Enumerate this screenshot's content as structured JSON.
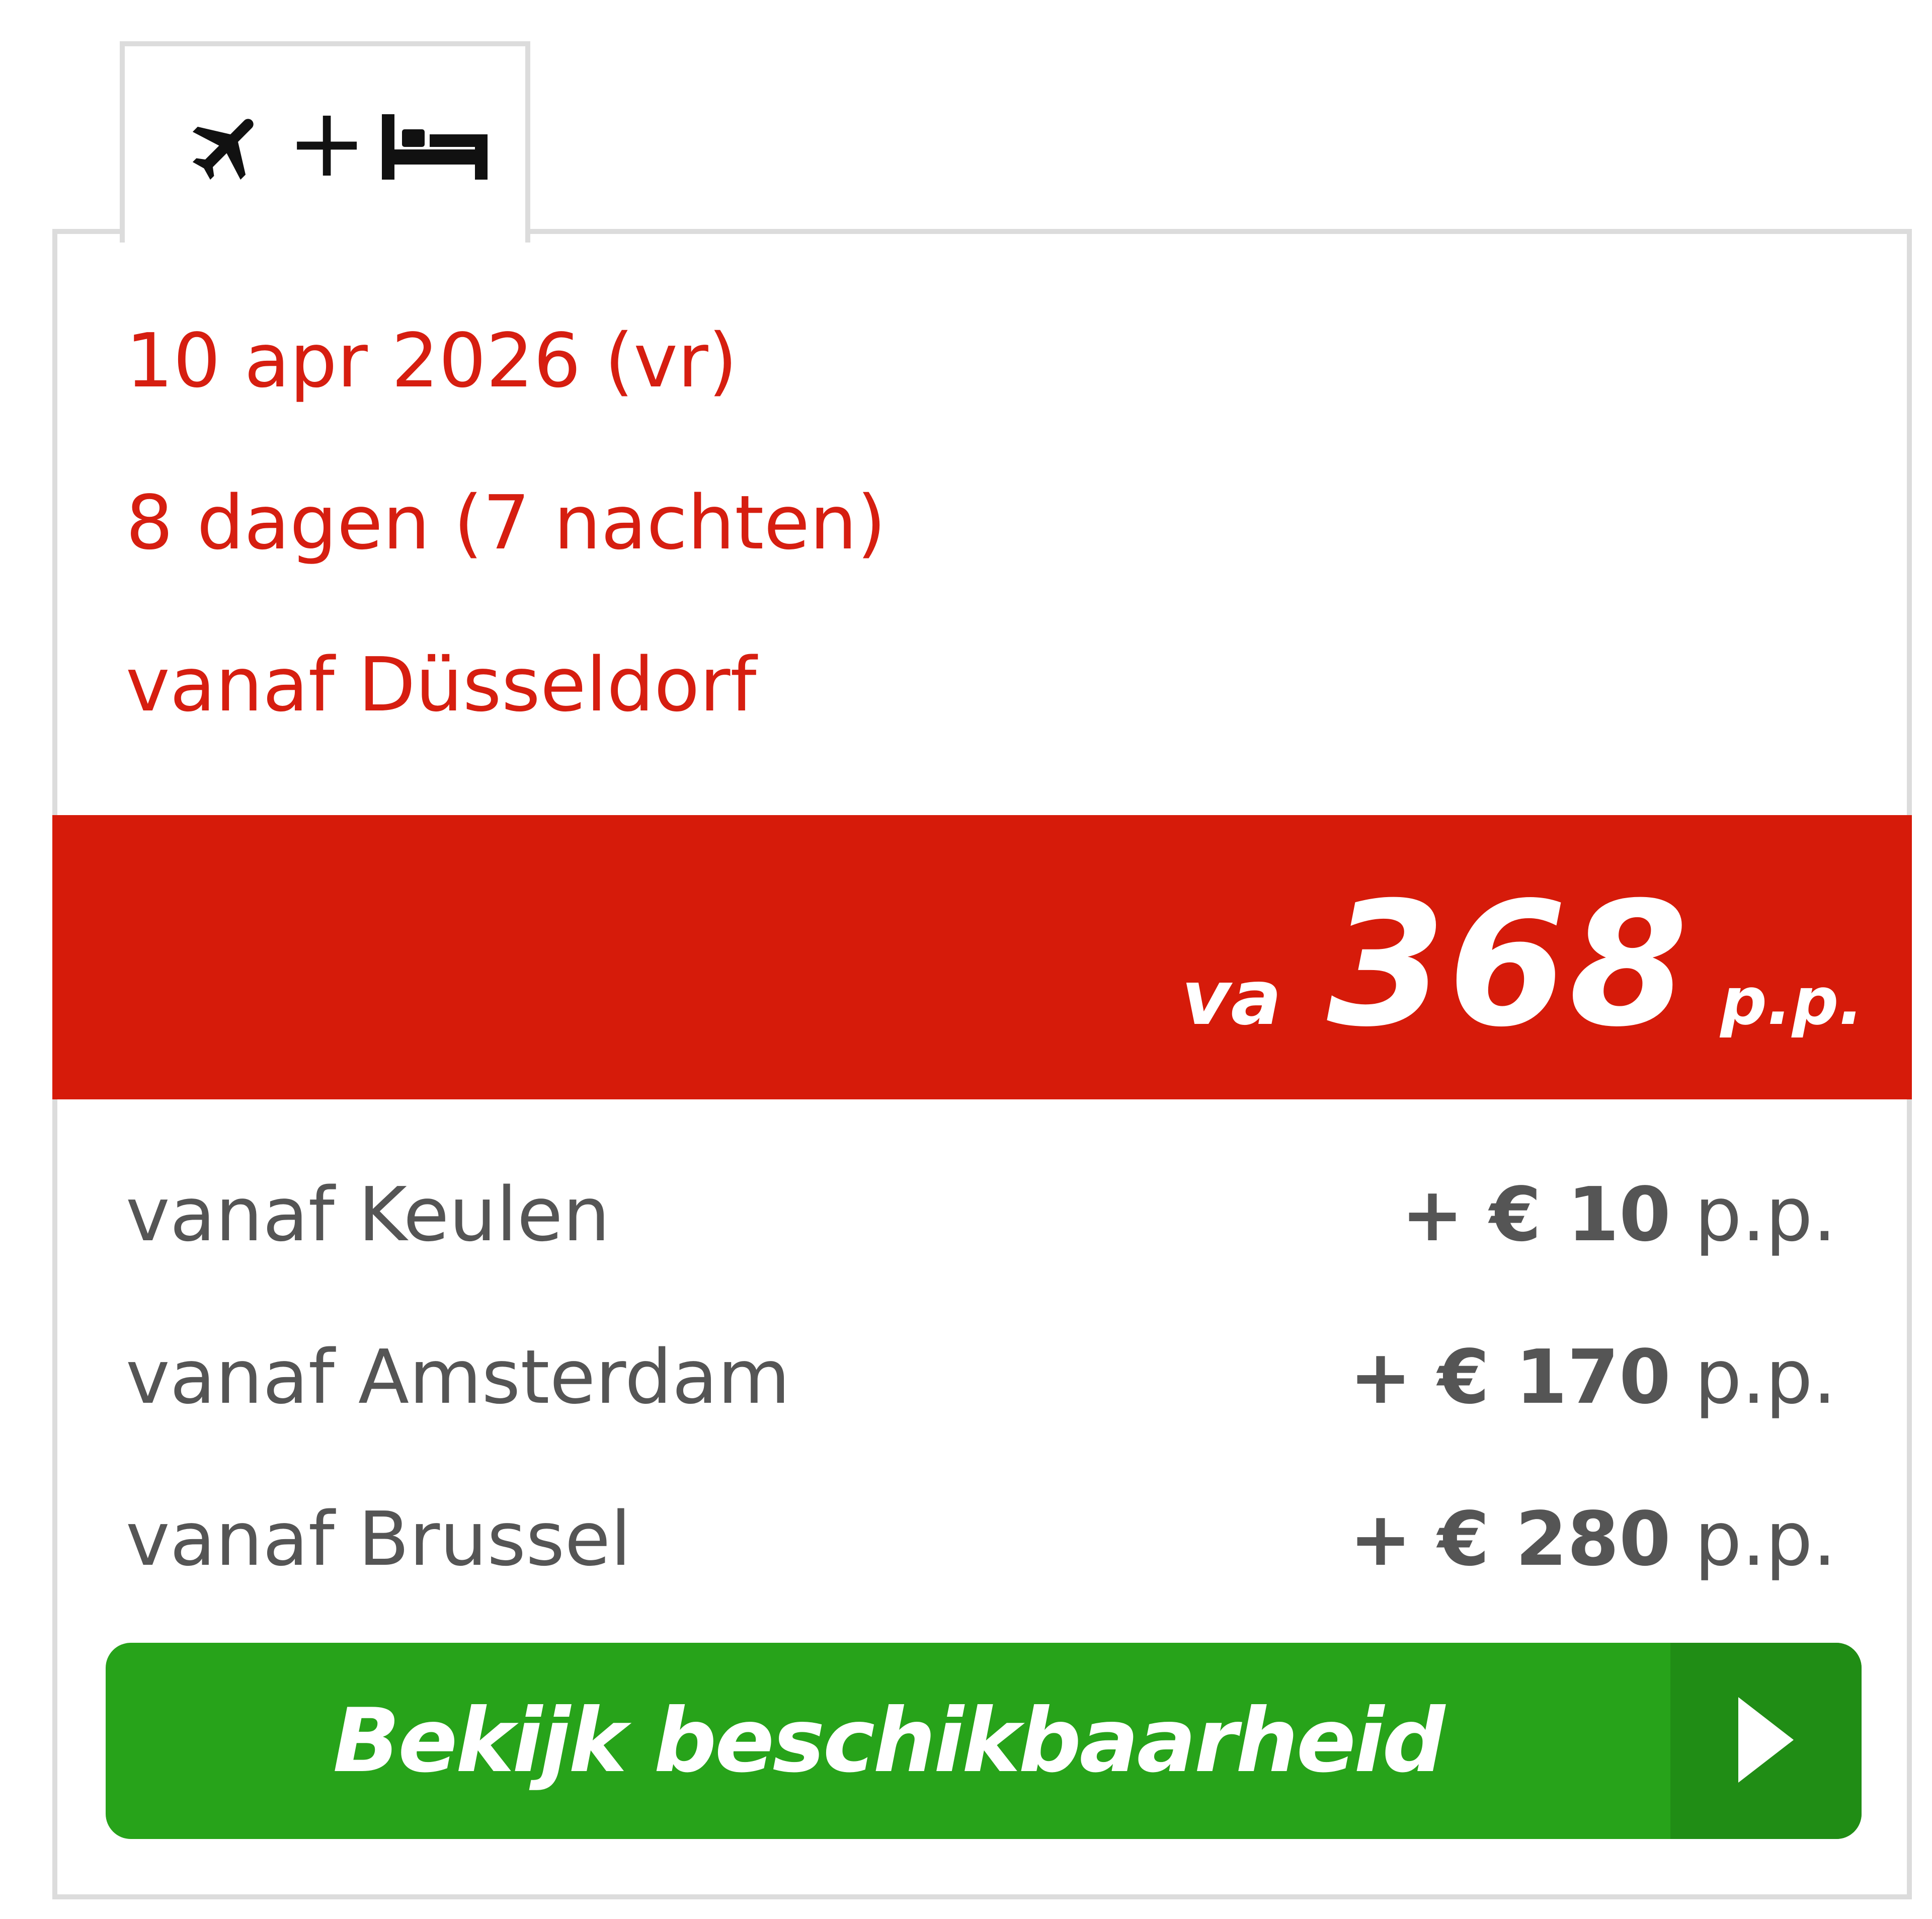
{
  "tab": {
    "icons": [
      "airplane-icon",
      "plus",
      "bed-icon"
    ],
    "plus_text": "+"
  },
  "trip": {
    "date": "10 apr 2026 (vr)",
    "duration": "8 dagen (7 nachten)",
    "departure": "vanaf Düsseldorf"
  },
  "price": {
    "prefix": "va",
    "amount": "368",
    "suffix": "p.p."
  },
  "alternatives": [
    {
      "label": "vanaf Keulen",
      "surcharge": "+ € 10",
      "unit": "p.p."
    },
    {
      "label": "vanaf Amsterdam",
      "surcharge": "+ € 170",
      "unit": "p.p."
    },
    {
      "label": "vanaf Brussel",
      "surcharge": "+ € 280",
      "unit": "p.p."
    }
  ],
  "cta": {
    "label": "Bekijk beschikbaarheid",
    "icon": "play-arrow-icon"
  },
  "colors": {
    "accent_red": "#d61b0a",
    "cta_green": "#27a31a",
    "cta_green_dark": "#208d15",
    "text_gray": "#555555",
    "border": "#dcdcdc"
  }
}
